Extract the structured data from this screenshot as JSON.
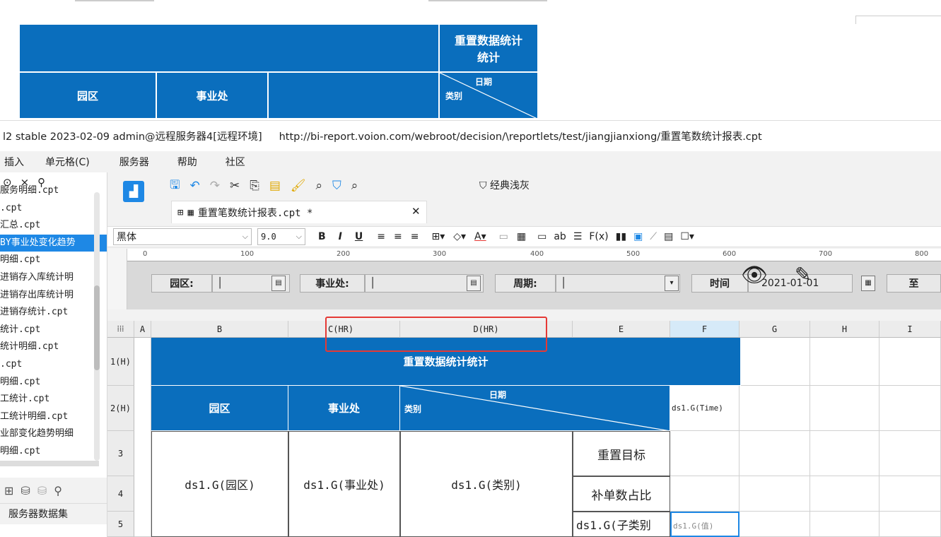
{
  "preview": {
    "title_line1": "重置数据统计",
    "title_line2": "统计",
    "col_park": "园区",
    "col_division": "事业处",
    "slash_date": "日期",
    "slash_category": "类别"
  },
  "titlebar": {
    "version": "l2 stable 2023-02-09 admin@远程服务器4[远程环境]",
    "url": "http://bi-report.voion.com/webroot/decision/\\reportlets/test/jiangjianxiong/重置笔数统计报表.cpt"
  },
  "menu": [
    "插入",
    "单元格(C)",
    "服务器",
    "帮助",
    "社区"
  ],
  "files": [
    "服务明细.cpt",
    ".cpt",
    "汇总.cpt",
    "BY事业处变化趋势",
    "明细.cpt",
    "进销存入库统计明",
    "进销存出库统计明",
    "进销存统计.cpt",
    "统计.cpt",
    "统计明细.cpt",
    ".cpt",
    "明细.cpt",
    "工统计.cpt",
    "工统计明细.cpt",
    "业部变化趋势明细",
    "明细.cpt"
  ],
  "dataset_label": "服务器数据集",
  "toolbar": {
    "classic": "经典浅灰",
    "tab_title": "重置笔数统计报表.cpt *",
    "font": "黑体",
    "size": "9.0",
    "bold": "B",
    "italic": "I",
    "underline": "U"
  },
  "ruler": [
    "0",
    "100",
    "200",
    "300",
    "400",
    "500",
    "600",
    "700",
    "800"
  ],
  "params": {
    "park": "园区:",
    "division": "事业处:",
    "period": "周期:",
    "time": "时间",
    "date": "2021-01-01",
    "to": "至"
  },
  "columns": [
    "A",
    "B",
    "C(HR)",
    "D(HR)",
    "E",
    "F",
    "G",
    "H",
    "I"
  ],
  "rows": [
    "1(H)",
    "2(H)",
    "3",
    "4",
    "5"
  ],
  "grid": {
    "title": "重置数据统计统计",
    "park": "园区",
    "division": "事业处",
    "slash_date": "日期",
    "slash_category": "类别",
    "time_cell": "ds1.G(Time)",
    "target": "重置目标",
    "ratio": "补单数占比",
    "ds_park": "ds1.G(园区)",
    "ds_division": "ds1.G(事业处)",
    "ds_category": "ds1.G(类别)",
    "ds_subcategory": "ds1.G(子类别",
    "ds_value": "ds1.G(值)"
  }
}
